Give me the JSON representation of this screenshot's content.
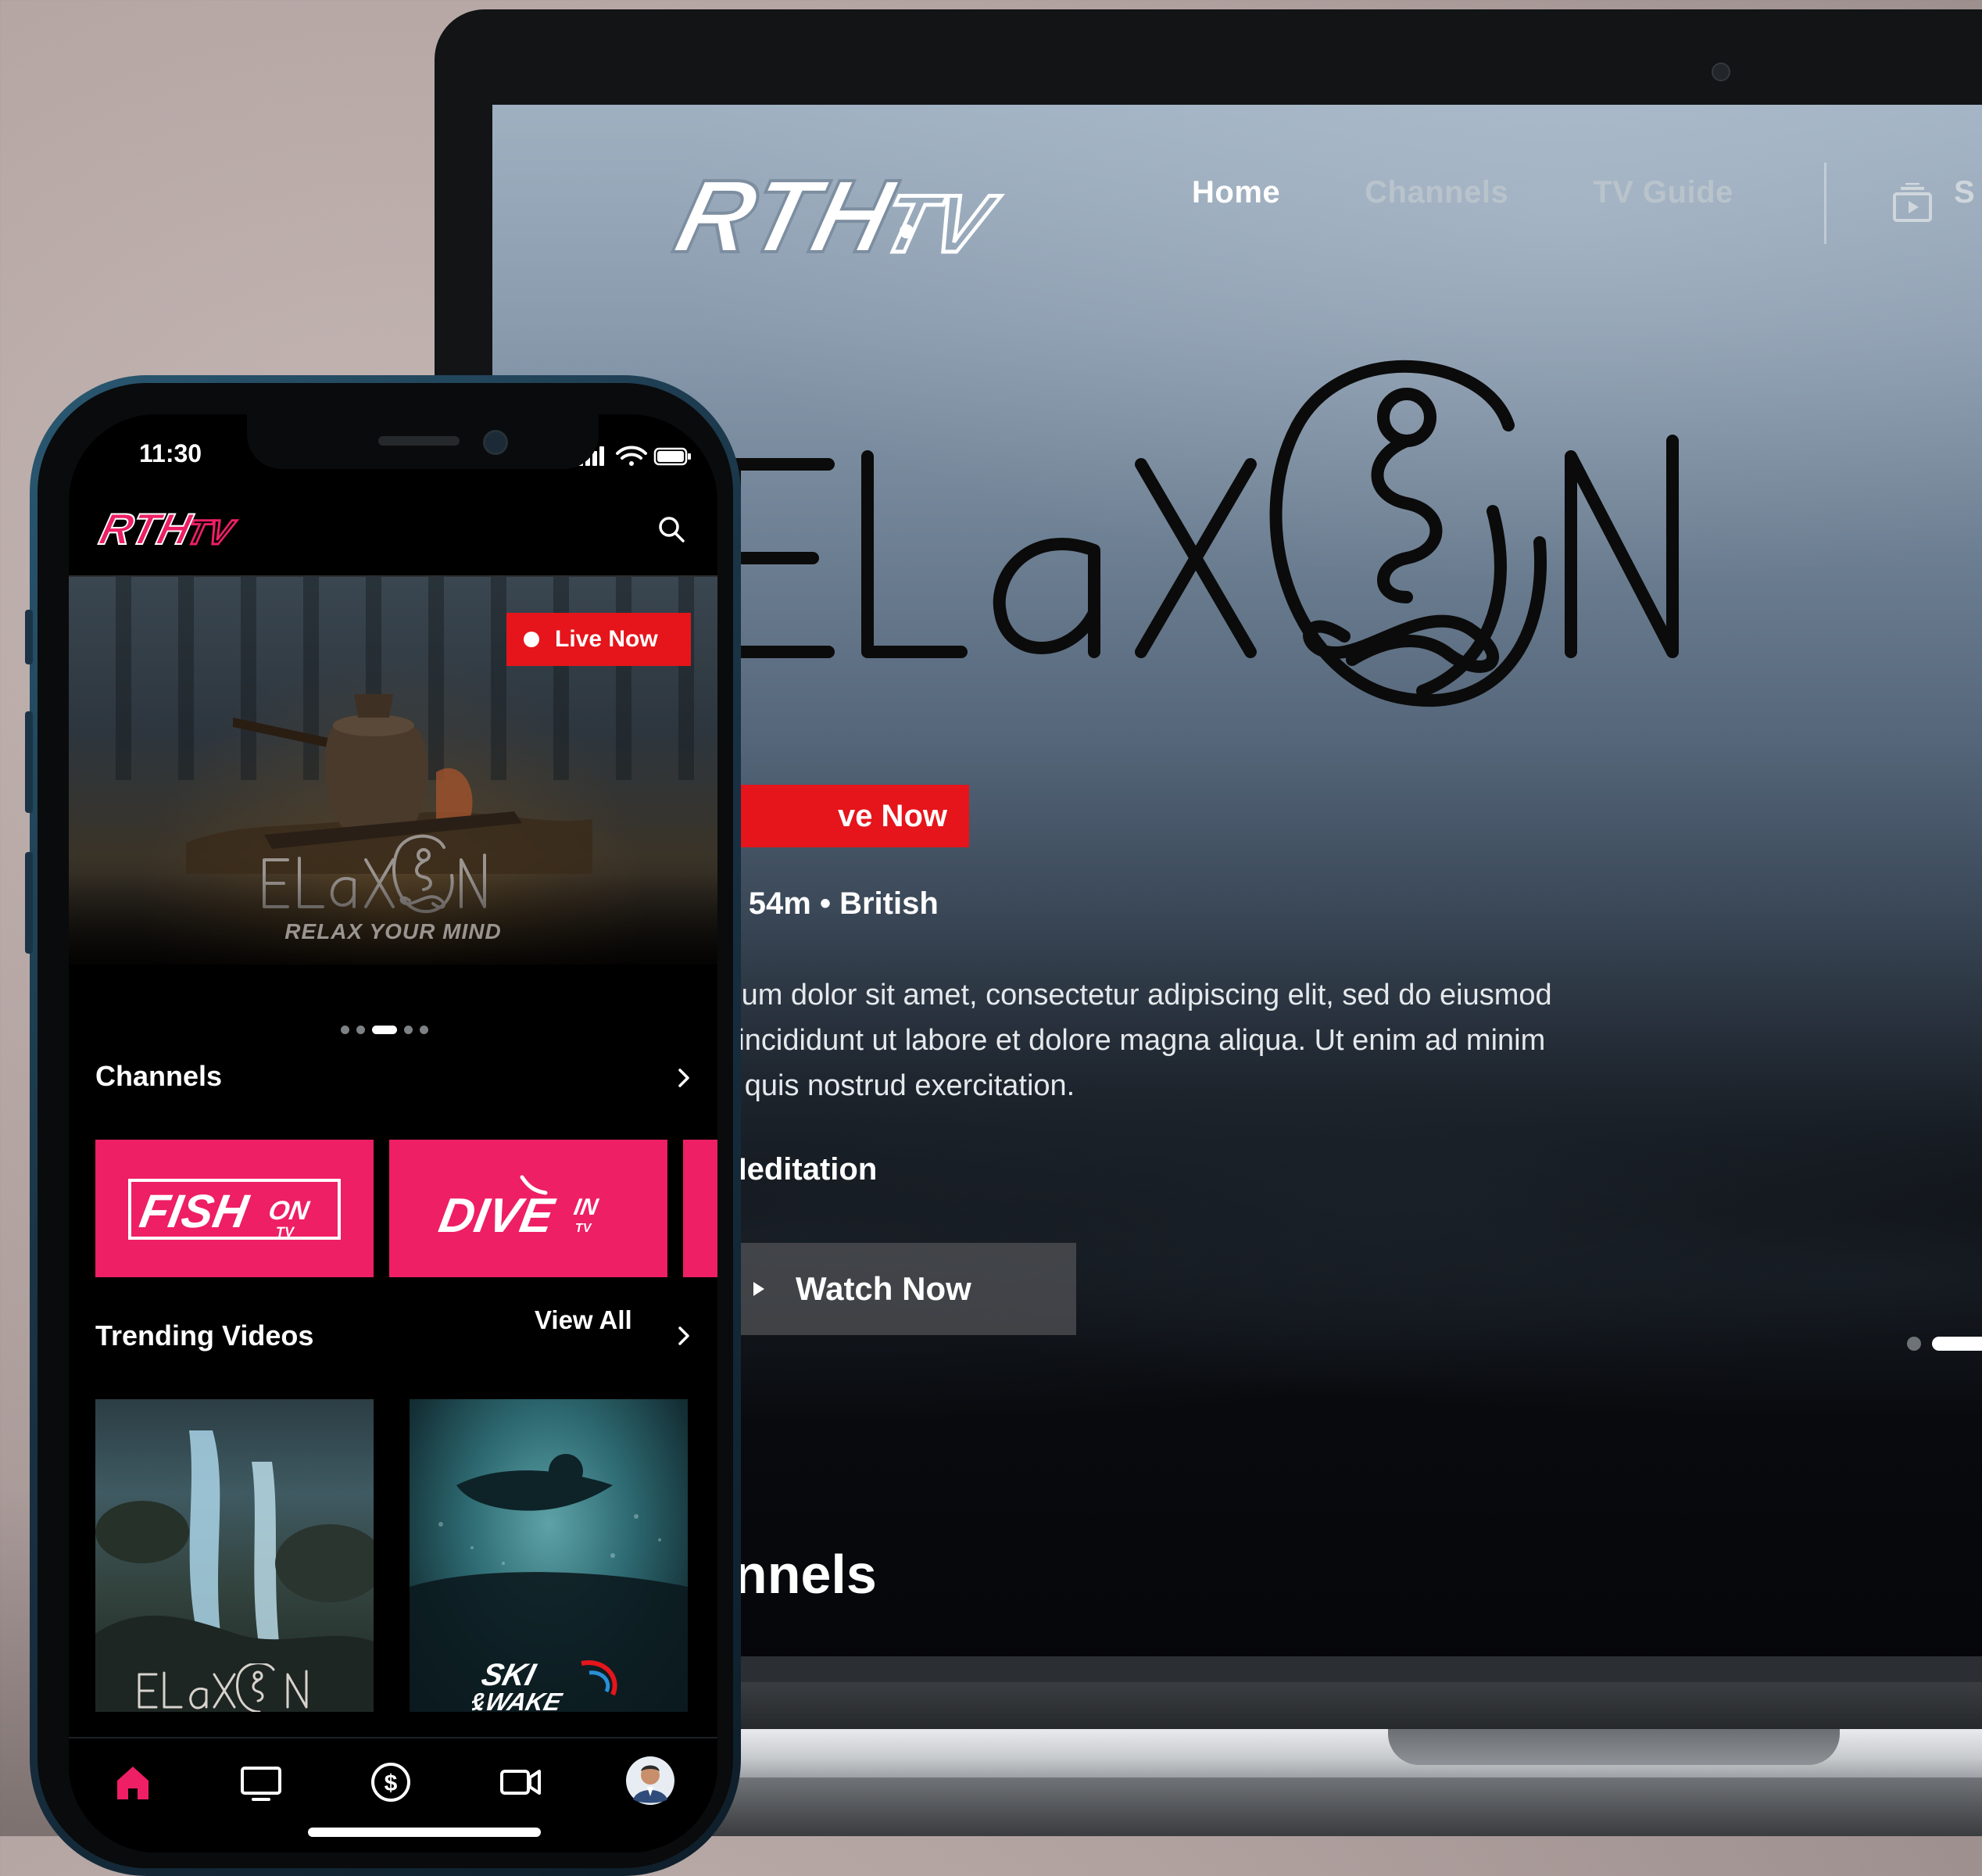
{
  "laptop": {
    "nav": {
      "home": "Home",
      "channels": "Channels",
      "tv_guide": "TV Guide",
      "cut_item": "S"
    },
    "hero": {
      "brand_text": "RELAX ON",
      "live_badge": "ve Now",
      "meta": "2h 54m • British",
      "description": [
        "ipsum dolor sit amet, consectetur adipiscing elit, sed do eiusmod",
        "or incididunt ut labore et dolore magna aliqua. Ut enim ad minim",
        "m, quis nostrud exercitation."
      ],
      "genre": "| Meditation",
      "watch_label": "Watch Now",
      "carousel_active_index": 1
    },
    "section_title": "annels"
  },
  "phone": {
    "status": {
      "time": "11:30"
    },
    "app_logo": "RTH TV",
    "hero": {
      "live_label": "Live Now",
      "brand_text": "RELAX ON",
      "tagline": "RELAX YOUR MIND",
      "carousel_active_index": 2
    },
    "channels": {
      "title": "Channels",
      "items": [
        "FISH ON TV",
        "DIVE IN TV"
      ]
    },
    "trending": {
      "title": "Trending Videos",
      "view_all": "View All",
      "items": [
        {
          "brand": "RELAX ON"
        },
        {
          "brand": "SKI & WAKE"
        }
      ]
    },
    "tabs": [
      "home",
      "tv",
      "dollar",
      "video",
      "profile"
    ],
    "colors": {
      "accent": "#ee1f64",
      "live_red": "#e5151b",
      "tab_active": "#ee1f64"
    }
  }
}
